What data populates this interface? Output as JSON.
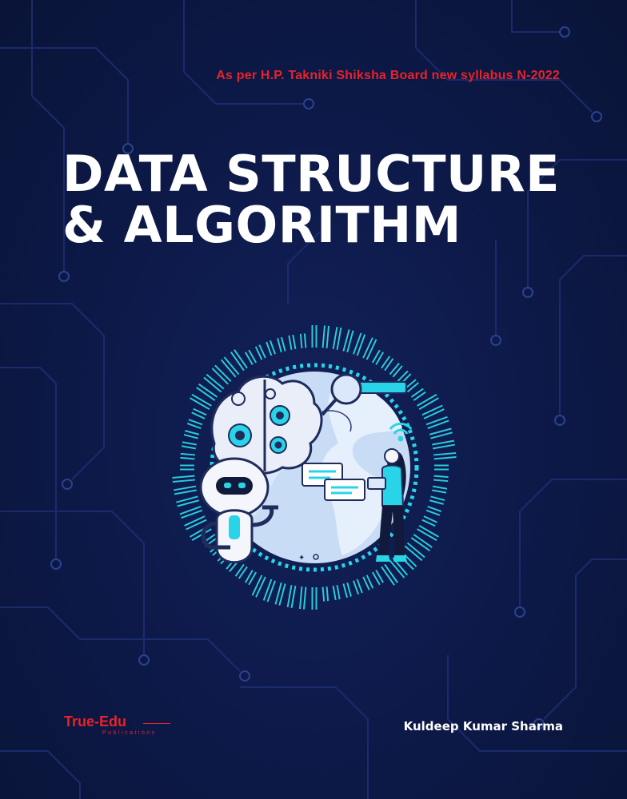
{
  "cover": {
    "syllabus_note": "As per H.P. Takniki Shiksha Board new syllabus N-2022",
    "title_line1": "DATA STRUCTURE",
    "title_line2": "& ALGORITHM",
    "author": "Kuldeep Kumar Sharma",
    "publisher_name": "True-Edu",
    "publisher_sub": "Publications"
  },
  "colors": {
    "background": "#0d1a4a",
    "accent_red": "#e8222a",
    "accent_cyan": "#2ad4e8",
    "title_white": "#ffffff"
  },
  "illustration": {
    "icons": [
      "globe-icon",
      "robot-icon",
      "brain-icon",
      "gear-icon",
      "magnifier-icon",
      "chat-bubble-icon",
      "wifi-icon",
      "woman-with-tablet-icon"
    ]
  }
}
